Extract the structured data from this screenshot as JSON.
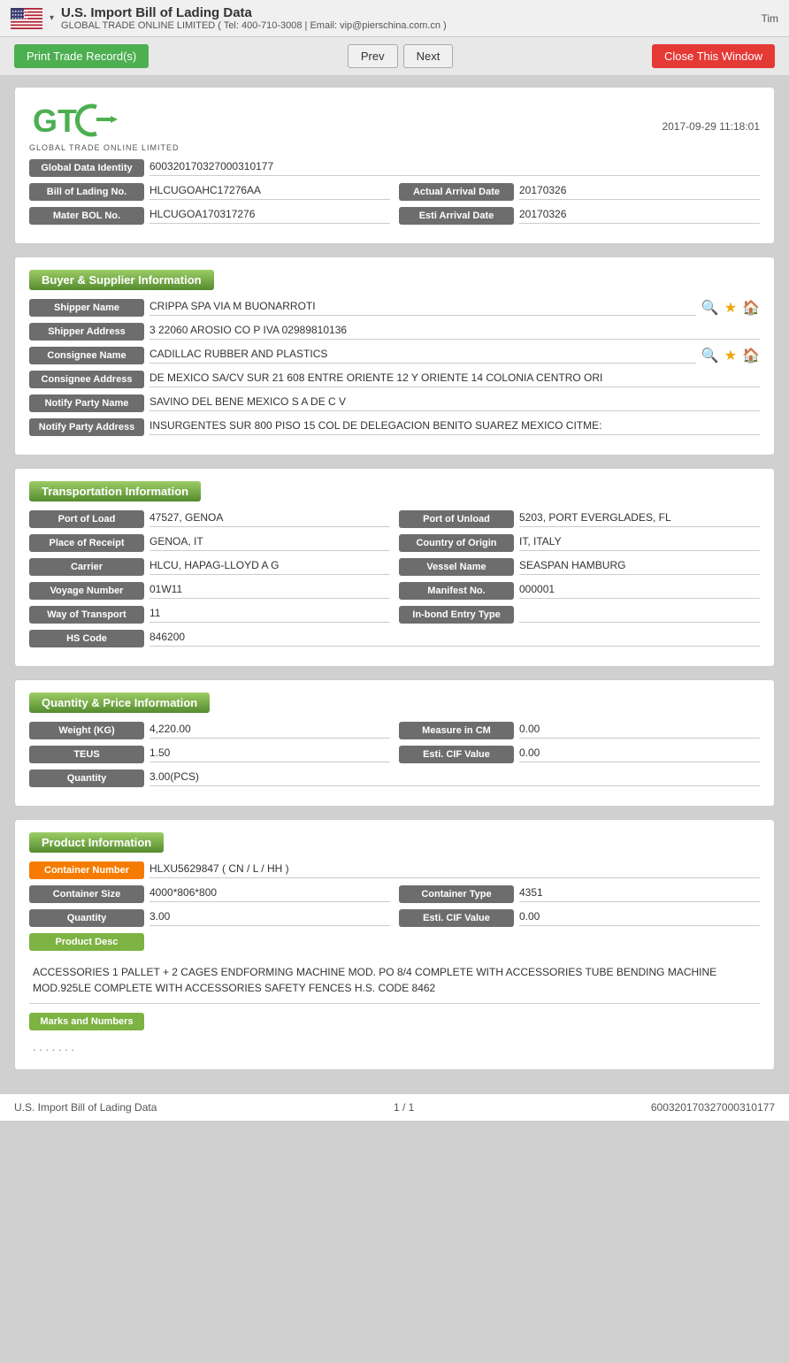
{
  "header": {
    "title": "U.S. Import Bill of Lading Data",
    "dropdown_arrow": "▾",
    "subtitle": "GLOBAL TRADE ONLINE LIMITED ( Tel: 400-710-3008 | Email: vip@pierschina.com.cn )",
    "tim_label": "Tim"
  },
  "toolbar": {
    "print_label": "Print Trade Record(s)",
    "prev_label": "Prev",
    "next_label": "Next",
    "close_label": "Close This Window"
  },
  "record_card": {
    "logo_text": "GTO",
    "logo_sub": "GLOBAL TRADE ONLINE LIMITED",
    "date": "2017-09-29 11:18:01",
    "global_data_identity_label": "Global Data Identity",
    "global_data_identity_value": "600320170327000310177",
    "bill_of_lading_label": "Bill of Lading No.",
    "bill_of_lading_value": "HLCUGOAHC17276AA",
    "actual_arrival_date_label": "Actual Arrival Date",
    "actual_arrival_date_value": "20170326",
    "mater_bol_label": "Mater BOL No.",
    "mater_bol_value": "HLCUGOA170317276",
    "esti_arrival_date_label": "Esti Arrival Date",
    "esti_arrival_date_value": "20170326"
  },
  "buyer_supplier": {
    "section_title": "Buyer & Supplier Information",
    "shipper_name_label": "Shipper Name",
    "shipper_name_value": "CRIPPA SPA VIA M BUONARROTI",
    "shipper_address_label": "Shipper Address",
    "shipper_address_value": "3 22060 AROSIO CO P IVA 02989810136",
    "consignee_name_label": "Consignee Name",
    "consignee_name_value": "CADILLAC RUBBER AND PLASTICS",
    "consignee_address_label": "Consignee Address",
    "consignee_address_value": "DE MEXICO SA/CV SUR 21 608 ENTRE ORIENTE 12 Y ORIENTE 14 COLONIA CENTRO ORI",
    "notify_party_name_label": "Notify Party Name",
    "notify_party_name_value": "SAVINO DEL BENE MEXICO S A DE C V",
    "notify_party_address_label": "Notify Party Address",
    "notify_party_address_value": "INSURGENTES SUR 800 PISO 15 COL DE DELEGACION BENITO SUAREZ MEXICO CITME:"
  },
  "transportation": {
    "section_title": "Transportation Information",
    "port_of_load_label": "Port of Load",
    "port_of_load_value": "47527, GENOA",
    "port_of_unload_label": "Port of Unload",
    "port_of_unload_value": "5203, PORT EVERGLADES, FL",
    "place_of_receipt_label": "Place of Receipt",
    "place_of_receipt_value": "GENOA, IT",
    "country_of_origin_label": "Country of Origin",
    "country_of_origin_value": "IT, ITALY",
    "carrier_label": "Carrier",
    "carrier_value": "HLCU, HAPAG-LLOYD A G",
    "vessel_name_label": "Vessel Name",
    "vessel_name_value": "SEASPAN HAMBURG",
    "voyage_number_label": "Voyage Number",
    "voyage_number_value": "01W11",
    "manifest_no_label": "Manifest No.",
    "manifest_no_value": "000001",
    "way_of_transport_label": "Way of Transport",
    "way_of_transport_value": "11",
    "in_bond_entry_type_label": "In-bond Entry Type",
    "in_bond_entry_type_value": "",
    "hs_code_label": "HS Code",
    "hs_code_value": "846200"
  },
  "quantity_price": {
    "section_title": "Quantity & Price Information",
    "weight_label": "Weight (KG)",
    "weight_value": "4,220.00",
    "measure_label": "Measure in CM",
    "measure_value": "0.00",
    "teus_label": "TEUS",
    "teus_value": "1.50",
    "esti_cif_label": "Esti. CIF Value",
    "esti_cif_value": "0.00",
    "quantity_label": "Quantity",
    "quantity_value": "3.00(PCS)"
  },
  "product_info": {
    "section_title": "Product Information",
    "container_number_label": "Container Number",
    "container_number_value": "HLXU5629847 ( CN / L / HH )",
    "container_size_label": "Container Size",
    "container_size_value": "4000*806*800",
    "container_type_label": "Container Type",
    "container_type_value": "4351",
    "quantity_label": "Quantity",
    "quantity_value": "3.00",
    "esti_cif_label": "Esti. CIF Value",
    "esti_cif_value": "0.00",
    "product_desc_label": "Product Desc",
    "product_desc_text": "ACCESSORIES 1 PALLET + 2 CAGES ENDFORMING MACHINE MOD. PO 8/4 COMPLETE WITH ACCESSORIES TUBE BENDING MACHINE MOD.925LE COMPLETE WITH ACCESSORIES SAFETY FENCES H.S. CODE 8462",
    "marks_label": "Marks and Numbers",
    "marks_value": ". . . . . . ."
  },
  "footer": {
    "page_title": "U.S. Import Bill of Lading Data",
    "page_num": "1 / 1",
    "record_id": "600320170327000310177"
  }
}
